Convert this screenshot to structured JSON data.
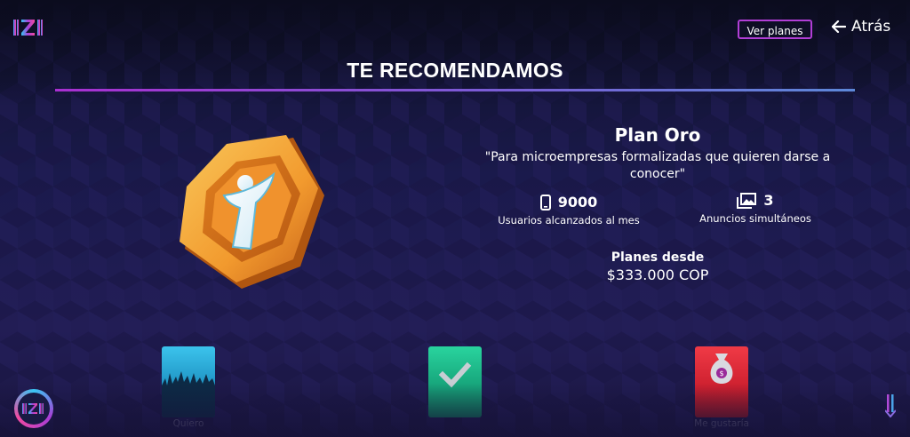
{
  "header": {
    "logo_text": "IZI",
    "ver_planes_label": "Ver planes",
    "back_label": "Atrás"
  },
  "recommendation": {
    "title": "TE RECOMENDAMOS",
    "plan_name": "Plan Oro",
    "plan_quote": "\"Para microempresas formalizadas que quieren darse a conocer\"",
    "stats": [
      {
        "value": "9000",
        "caption": "Usuarios alcanzados al mes",
        "icon": "phone-icon"
      },
      {
        "value": "3",
        "caption": "Anuncios simultáneos",
        "icon": "images-icon"
      }
    ],
    "price_label": "Planes desde",
    "price": "$333.000 COP"
  },
  "cards": [
    {
      "label": "Quiero",
      "icon": "crowd-icon"
    },
    {
      "label": "",
      "icon": "checkmark-icon"
    },
    {
      "label": "Me gustaría",
      "icon": "money-bag-icon"
    }
  ],
  "colors": {
    "accent_purple": "#b13ed6",
    "badge_orange": "#f2a23b",
    "card_blue": "#2fb1dc",
    "card_green": "#1fb68a",
    "card_red": "#e12e3c"
  }
}
